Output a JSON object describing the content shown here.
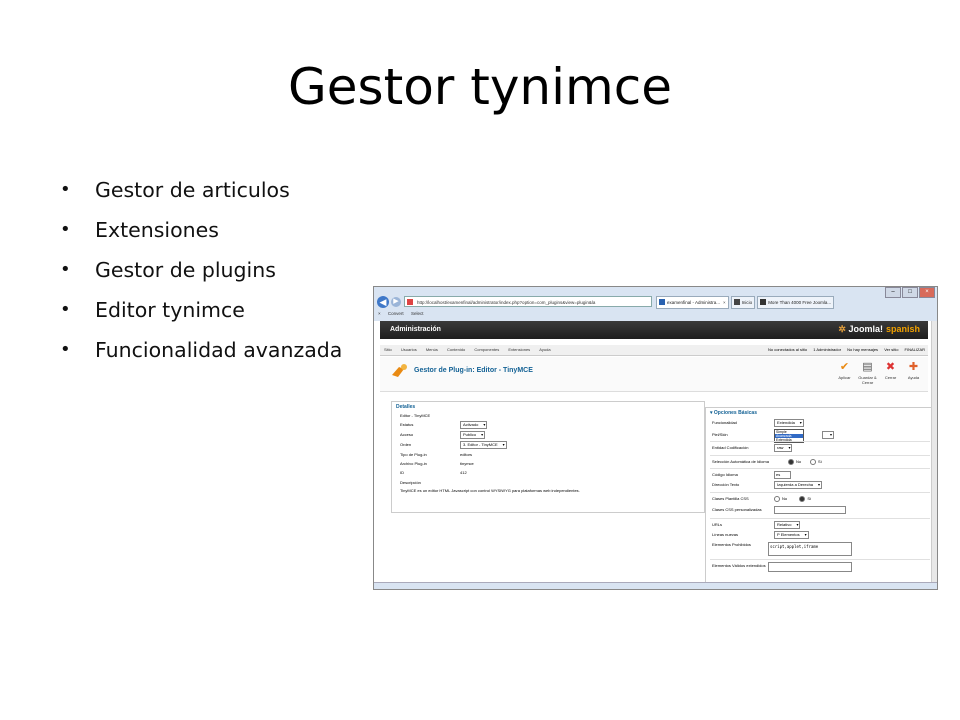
{
  "slide": {
    "title": "Gestor tynimce",
    "bullets": [
      "Gestor de articulos",
      "Extensiones",
      "Gestor de plugins",
      "Editor tynimce",
      "Funcionalidad avanzada"
    ]
  },
  "browser": {
    "url": "http://localhost/examenfinal/administrator/index.php?option=com_plugins&view=plugin&la",
    "tabs": [
      {
        "label": "examenfinal - Administra...",
        "active": true
      },
      {
        "label": "Inicio",
        "active": false
      },
      {
        "label": "More Than 4000 Free Joomla...",
        "active": false
      }
    ],
    "command_bar": [
      "Convert",
      "Select"
    ]
  },
  "admin": {
    "title": "Administración",
    "logo_text": "Joomla!",
    "logo_suffix": "spanish",
    "menu": [
      "Sitio",
      "Usuarios",
      "Menús",
      "Contenido",
      "Componentes",
      "Extensiones",
      "Ayuda"
    ],
    "status": [
      "No conectados al sitio",
      "1 Administrador",
      "No hay mensajes",
      "Ver sitio",
      "FINALIZAR"
    ]
  },
  "toolbar": {
    "title": "Gestor de Plug-in: Editor - TinyMCE",
    "buttons": [
      "Aplicar",
      "Guardar & Cerrar",
      "Cerrar",
      "Ayuda"
    ]
  },
  "details": {
    "title": "Detalles",
    "subtitle": "Editor - TinyMCE",
    "rows": [
      {
        "label": "Estatus",
        "value": "Activado"
      },
      {
        "label": "Acceso",
        "value": "Publico"
      },
      {
        "label": "Orden",
        "value": "3. Editor - TinyMCE"
      },
      {
        "label": "Tipo de Plug-in",
        "value": "editors"
      },
      {
        "label": "Archivo Plug-in",
        "value": "tinymce"
      },
      {
        "label": "ID",
        "value": "412"
      },
      {
        "label": "Descripción",
        "value": ""
      }
    ],
    "description": "TinyMCE es un editor HTML Javascript con control WYSIWYG para plataformas web independientes."
  },
  "options": {
    "title": "Opciones Básicas",
    "funcionalidad": {
      "label": "Funcionalidad",
      "value": "Extendida",
      "options": [
        "Simple",
        "Avanzada",
        "Extendida"
      ]
    },
    "piel": {
      "label": "Piel/Skin"
    },
    "entidad": {
      "label": "Entidad Codificación",
      "value": "raw"
    },
    "seleccion_idioma": {
      "label": "Selección Automática de Idioma",
      "no": "No",
      "si": "Sí"
    },
    "codigo_idioma": {
      "label": "Código Idioma",
      "value": "es"
    },
    "direccion": {
      "label": "Dirección Texto",
      "value": "Izquierda a Derecha"
    },
    "clases_css": {
      "label": "Clases Plantilla CSS",
      "no": "No",
      "si": "Sí"
    },
    "clases_css_pers": {
      "label": "Clases CSS personalizadas"
    },
    "urls": {
      "label": "URLs",
      "value": "Relativo"
    },
    "lineas": {
      "label": "Líneas nuevas",
      "value": "P Elementos"
    },
    "prohibidos": {
      "label": "Elementos Prohibidos",
      "value": "script,applet,iframe"
    },
    "validos": {
      "label": "Elementos Válidos extendidos"
    }
  }
}
